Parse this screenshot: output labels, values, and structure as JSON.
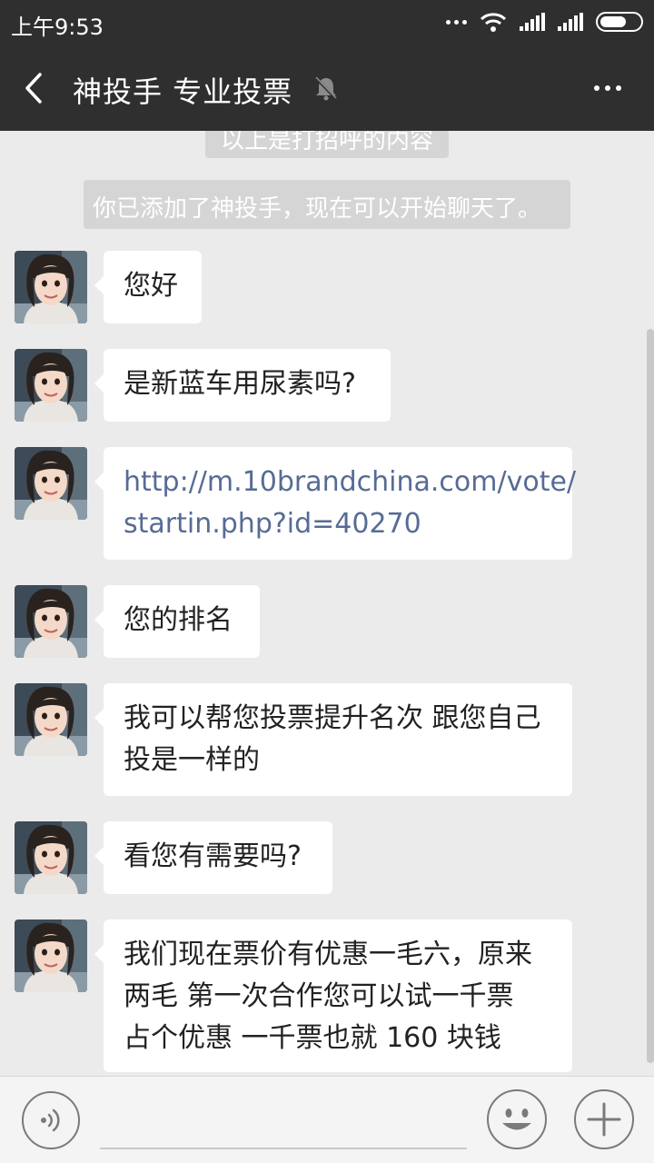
{
  "status_bar": {
    "time": "上午9:53"
  },
  "header": {
    "title": "神投手 专业投票"
  },
  "system_messages": [
    "以上是打招呼的内容",
    "你已添加了神投手，现在可以开始聊天了。"
  ],
  "messages": [
    {
      "text": "您好"
    },
    {
      "text": "是新蓝车用尿素吗?"
    },
    {
      "line1": "http://m.10brandchina.com/vote/",
      "line2": "startin.php?id=40270"
    },
    {
      "text": "您的排名"
    },
    {
      "line1": "我可以帮您投票提升名次 跟您自己",
      "line2": "投是一样的"
    },
    {
      "text": "看您有需要吗?"
    },
    {
      "line1": "我们现在票价有优惠一毛六，原来",
      "line2": "两毛  第一次合作您可以试一千票",
      "line3": "占个优惠   一千票也就 160 块钱"
    }
  ],
  "icons": {
    "back": "chevron-left-icon",
    "mute": "bell-muted-icon",
    "more": "more-dots-icon",
    "voice": "voice-icon",
    "emoji": "smiley-icon",
    "plus": "plus-icon"
  },
  "colors": {
    "header_bg": "#2f2f2f",
    "chat_bg": "#ebebeb",
    "bubble_bg": "#ffffff",
    "link": "#576b95",
    "system_msg_bg": "#d5d5d5"
  }
}
